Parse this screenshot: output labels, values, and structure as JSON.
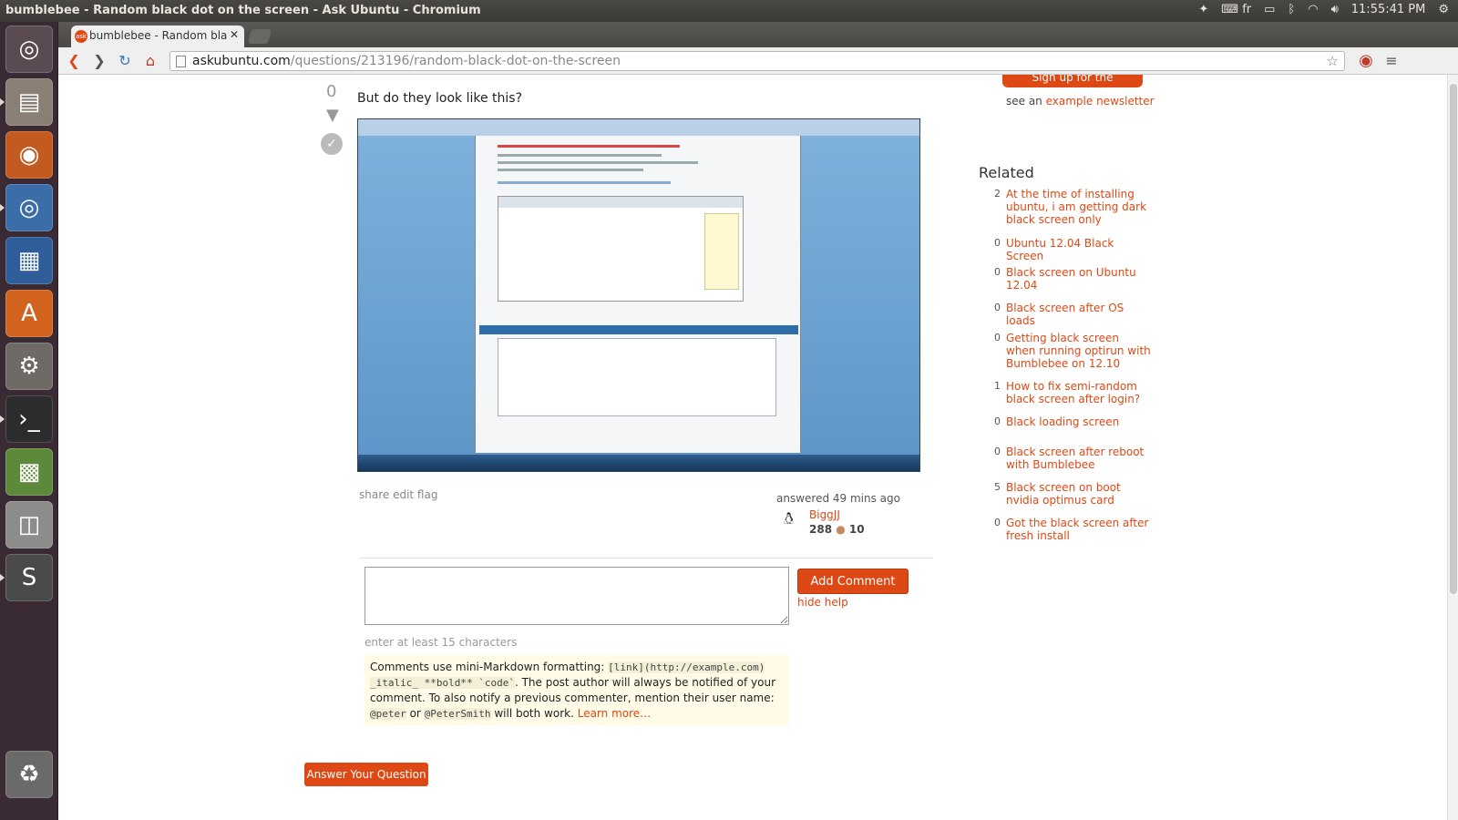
{
  "window": {
    "title": "bumblebee - Random black dot on the screen - Ask Ubuntu - Chromium"
  },
  "tray": {
    "keyboard": "fr",
    "time": "11:55:41 PM"
  },
  "launcher": {
    "items": [
      "dash-home",
      "file-manager",
      "firefox",
      "chromium",
      "libreoffice-writer",
      "software-center",
      "system-settings",
      "terminal",
      "minecraft",
      "disk",
      "sublime-text",
      "trash"
    ]
  },
  "browser": {
    "tab_title": "bumblebee - Random bla",
    "tab_favicon": "ask",
    "url_domain": "askubuntu.com",
    "url_path": "/questions/213196/random-black-dot-on-the-screen"
  },
  "post": {
    "vote_count": "0",
    "text": "But do they look like this?",
    "menu": "share  edit  flag",
    "answered": "answered 49 mins ago",
    "user": "BiggJJ",
    "rep": "288",
    "bronze": "10"
  },
  "comment": {
    "add_label": "Add Comment",
    "hide_help": "hide help",
    "hint": "enter at least 15 characters",
    "help_line1": "Comments use mini-Markdown formatting: ",
    "code1": "[link](http://example.com)",
    "code2": "_italic_ **bold** `code`",
    "help_line2": ". The post author will always be notified of your comment. To also notify a previous commenter, mention their user name: ",
    "code3": "@peter",
    "or": " or ",
    "code4": "@PeterSmith",
    "help_line3": " will both work. ",
    "learn_more": "Learn more…"
  },
  "answer_button": "Answer Your Question",
  "sidebar": {
    "newsletter_button": "Sign up for the newsletter",
    "newsletter_text": "see an ",
    "newsletter_link": "example newsletter",
    "related_title": "Related",
    "related": [
      {
        "score": "2",
        "title": "At the time of installing ubuntu, i am getting dark black screen only"
      },
      {
        "score": "0",
        "title": "Ubuntu 12.04 Black Screen"
      },
      {
        "score": "0",
        "title": "Black screen on Ubuntu 12.04"
      },
      {
        "score": "0",
        "title": "Black screen after OS loads"
      },
      {
        "score": "0",
        "title": "Getting black screen when running optirun with Bumblebee on 12.10"
      },
      {
        "score": "1",
        "title": "How to fix semi-random black screen after login?"
      },
      {
        "score": "0",
        "title": "Black loading screen"
      },
      {
        "score": "0",
        "title": "Black screen after reboot with Bumblebee"
      },
      {
        "score": "5",
        "title": "Black screen on boot nvidia optimus card"
      },
      {
        "score": "0",
        "title": "Got the black screen after fresh install"
      }
    ]
  },
  "colors": {
    "accent": "#dd4814",
    "launcher": "#3a2a34",
    "topbar": "#3c3b37"
  }
}
